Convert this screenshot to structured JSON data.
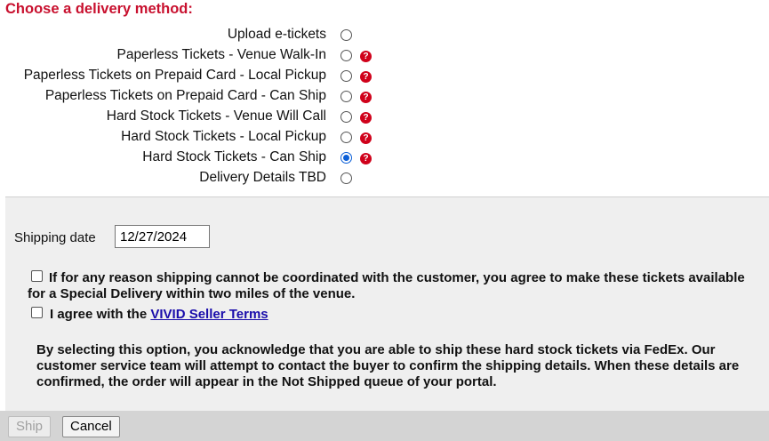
{
  "heading": "Choose a delivery method:",
  "delivery_options": [
    {
      "label": "Upload e-tickets",
      "selected": false,
      "help": false
    },
    {
      "label": "Paperless Tickets - Venue Walk-In",
      "selected": false,
      "help": true
    },
    {
      "label": "Paperless Tickets on Prepaid Card - Local Pickup",
      "selected": false,
      "help": true
    },
    {
      "label": "Paperless Tickets on Prepaid Card - Can Ship",
      "selected": false,
      "help": true
    },
    {
      "label": "Hard Stock Tickets - Venue Will Call",
      "selected": false,
      "help": true
    },
    {
      "label": "Hard Stock Tickets - Local Pickup",
      "selected": false,
      "help": true
    },
    {
      "label": "Hard Stock Tickets - Can Ship",
      "selected": true,
      "help": true
    },
    {
      "label": "Delivery Details TBD",
      "selected": false,
      "help": false
    }
  ],
  "help_icon_glyph": "?",
  "shipping": {
    "label": "Shipping date",
    "value": "12/27/2024"
  },
  "special_delivery": {
    "text": "If for any reason shipping cannot be coordinated with the customer, you agree to make these tickets available for a Special Delivery within two miles of the venue.",
    "checked": false
  },
  "seller_terms": {
    "prefix": "I agree with the ",
    "link": "VIVID Seller Terms",
    "checked": false
  },
  "info_text": "By selecting this option, you acknowledge that you are able to ship these hard stock tickets via FedEx. Our customer service team will attempt to contact the buyer to confirm the shipping details. When these details are confirmed, the order will appear in the Not Shipped queue of your portal.",
  "buttons": {
    "ship": "Ship",
    "cancel": "Cancel"
  },
  "colors": {
    "heading": "#c8102e",
    "help_icon": "#d0021b",
    "radio_selected": "#0a5ed7",
    "link": "#1a0dab",
    "panel_bg": "#efefef",
    "footer_bg": "#d4d4d4"
  }
}
